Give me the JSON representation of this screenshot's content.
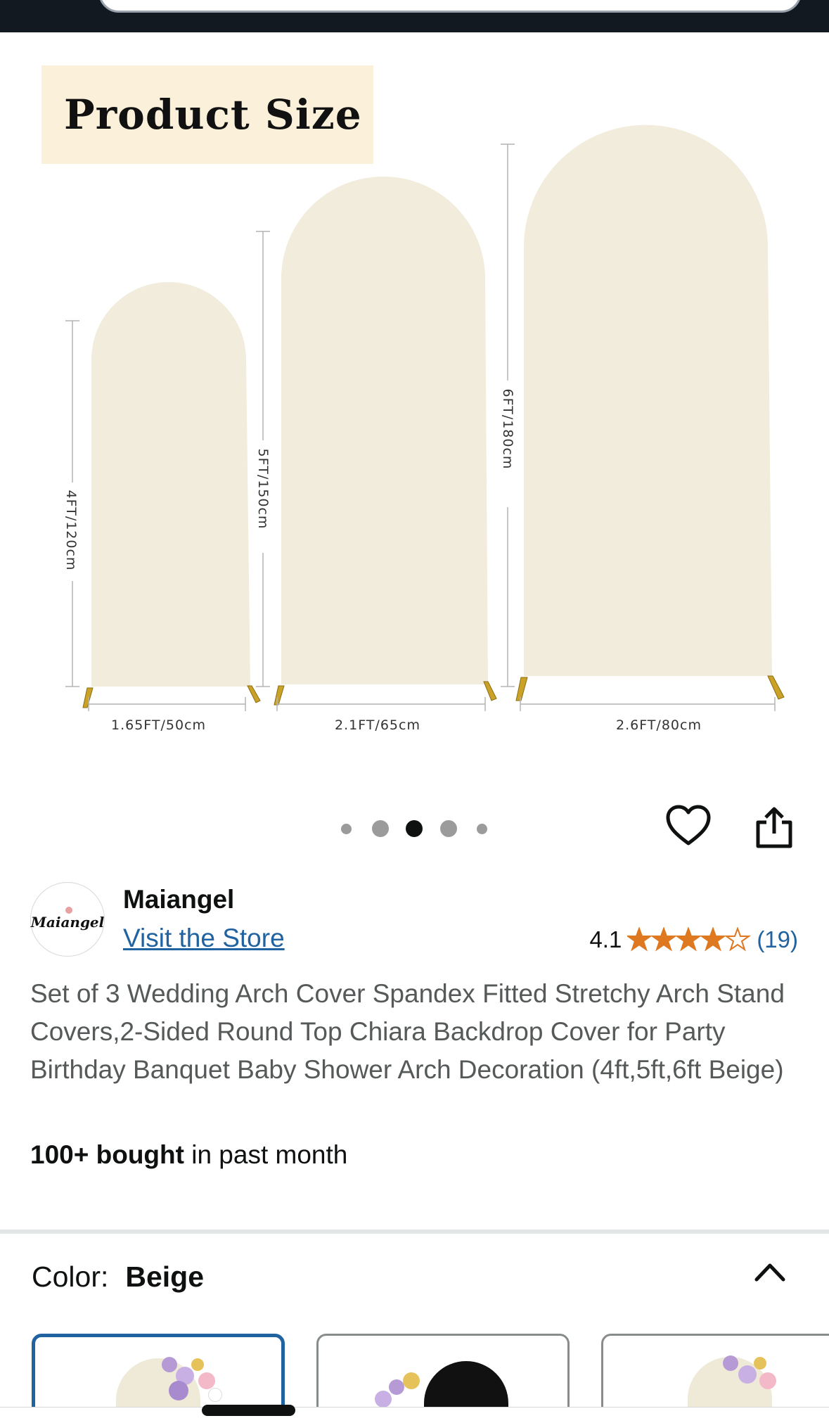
{
  "gallery": {
    "label": "Product Size",
    "arches": [
      {
        "height": "4FT/120cm",
        "width": "1.65FT/50cm"
      },
      {
        "height": "5FT/150cm",
        "width": "2.1FT/65cm"
      },
      {
        "height": "6FT/180cm",
        "width": "2.6FT/80cm"
      }
    ],
    "image_count": 5,
    "active_index": 2
  },
  "actions": {
    "wishlist_icon": "heart-outline-icon",
    "share_icon": "share-icon"
  },
  "brand": {
    "logo_text": "Maiangel",
    "name": "Maiangel",
    "store_link": "Visit the Store"
  },
  "rating": {
    "value": "4.1",
    "stars": 4.1,
    "count": "(19)"
  },
  "product": {
    "title": "Set of 3 Wedding Arch Cover Spandex Fitted Stretchy Arch Stand Covers,2-Sided Round Top Chiara Backdrop Cover for Party Birthday Banquet Baby Shower Arch Decoration (4ft,5ft,6ft Beige)",
    "bought_bold": "100+ bought",
    "bought_rest": " in past month"
  },
  "variant": {
    "label": "Color:",
    "selected": "Beige",
    "swatches": [
      {
        "name": "beige",
        "color": "#efe9d7"
      },
      {
        "name": "black",
        "color": "#111111"
      },
      {
        "name": "beige-2",
        "color": "#efe9d7"
      }
    ]
  },
  "colors": {
    "accent_link": "#2162a1",
    "star": "#de7921",
    "arch_fill": "#f2ecdc",
    "label_bg": "#fbf1db"
  }
}
